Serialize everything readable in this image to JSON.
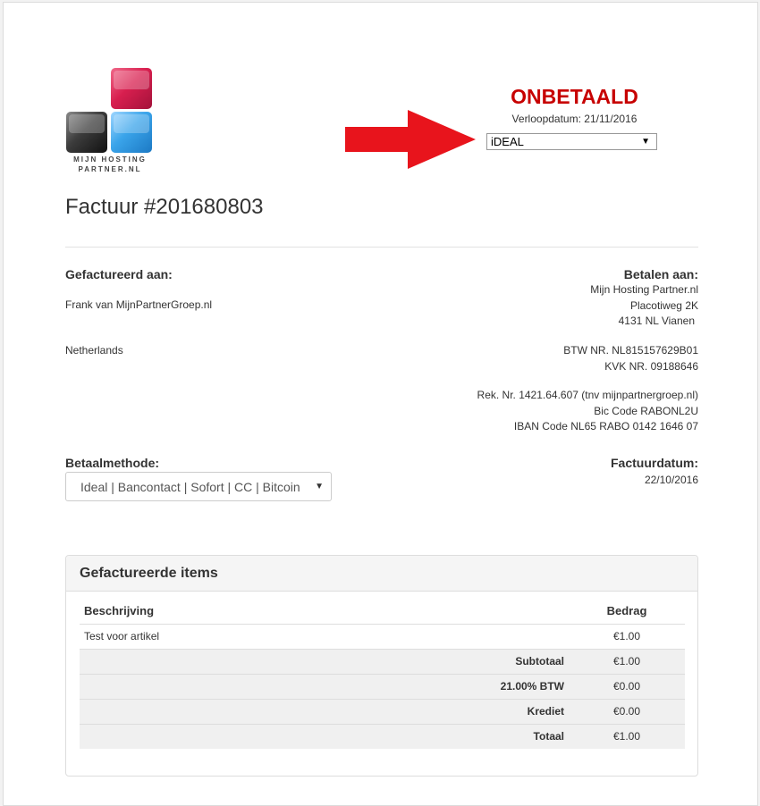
{
  "logo": {
    "line1": "MIJN HOSTING",
    "line2": "PARTNER.NL"
  },
  "invoice": {
    "status": "ONBETAALD",
    "due_date": "Verloopdatum: 21/11/2016",
    "gateway_selected": "iDEAL",
    "title": "Factuur #201680803"
  },
  "billed_to": {
    "label": "Gefactureerd aan:",
    "name": "Frank  van MijnPartnerGroep.nl",
    "country": "Netherlands"
  },
  "pay_to": {
    "label": "Betalen aan:",
    "lines": [
      "Mijn Hosting Partner.nl",
      "Placotiweg 2K",
      "4131 NL Vianen"
    ],
    "tax_lines": [
      "BTW NR. NL815157629B01",
      "KVK NR. 09188646"
    ],
    "bank_lines": [
      "Rek. Nr. 1421.64.607 (tnv mijnpartnergroep.nl)",
      "Bic Code RABONL2U",
      "IBAN Code NL65 RABO 0142 1646 07"
    ]
  },
  "payment_method": {
    "label": "Betaalmethode:",
    "selected": "Ideal | Bancontact | Sofort | CC | Bitcoin"
  },
  "invoice_date": {
    "label": "Factuurdatum:",
    "value": "22/10/2016"
  },
  "items": {
    "title": "Gefactureerde items",
    "headers": {
      "description": "Beschrijving",
      "amount": "Bedrag"
    },
    "rows": [
      {
        "description": "Test voor artikel",
        "amount": "€1.00"
      }
    ],
    "summary": [
      {
        "label": "Subtotaal",
        "amount": "€1.00"
      },
      {
        "label": "21.00% BTW",
        "amount": "€0.00"
      },
      {
        "label": "Krediet",
        "amount": "€0.00"
      },
      {
        "label": "Totaal",
        "amount": "€1.00"
      }
    ]
  },
  "annotation": {
    "arrow_color": "#e8141c"
  },
  "colors": {
    "status_red": "#c70000"
  }
}
